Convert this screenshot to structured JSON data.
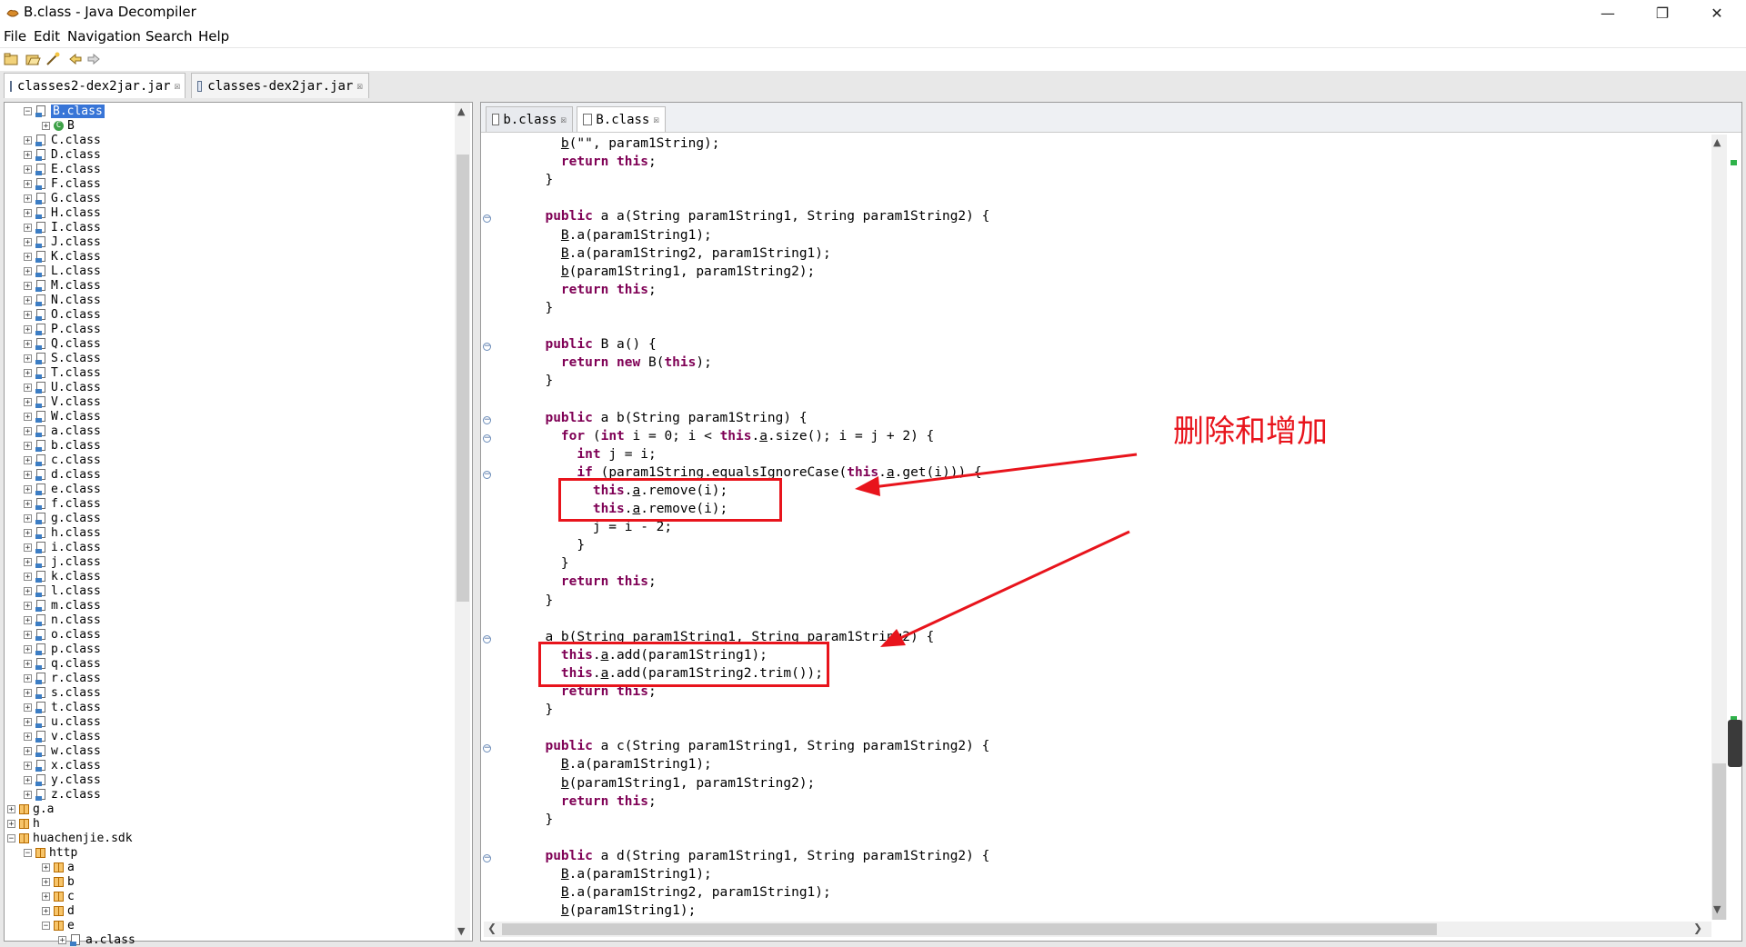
{
  "window": {
    "title": "B.class - Java Decompiler",
    "controls": [
      "minimize",
      "restore",
      "close"
    ]
  },
  "menu": [
    "File",
    "Edit",
    "Navigation",
    "Search",
    "Help"
  ],
  "toolbar": [
    "open-file-icon",
    "open-folder-icon",
    "wand-icon",
    "back-arrow-icon",
    "forward-arrow-icon"
  ],
  "editor_tabs": [
    {
      "label": "classes2-dex2jar.jar",
      "active": true
    },
    {
      "label": "classes-dex2jar.jar",
      "active": false
    }
  ],
  "tree": {
    "selected": "B.class",
    "child_class": "B",
    "classes": [
      "C.class",
      "D.class",
      "E.class",
      "F.class",
      "G.class",
      "H.class",
      "I.class",
      "J.class",
      "K.class",
      "L.class",
      "M.class",
      "N.class",
      "O.class",
      "P.class",
      "Q.class",
      "S.class",
      "T.class",
      "U.class",
      "V.class",
      "W.class",
      "a.class",
      "b.class",
      "c.class",
      "d.class",
      "e.class",
      "f.class",
      "g.class",
      "h.class",
      "i.class",
      "j.class",
      "k.class",
      "l.class",
      "m.class",
      "n.class",
      "o.class",
      "p.class",
      "q.class",
      "r.class",
      "s.class",
      "t.class",
      "u.class",
      "v.class",
      "w.class",
      "x.class",
      "y.class",
      "z.class"
    ],
    "packages_after": [
      "g.a",
      "h",
      "huachenjie.sdk"
    ],
    "sub_package": "http",
    "sub_sub_packages": [
      "a",
      "b",
      "c",
      "d",
      "e"
    ],
    "last_partial": "a.class"
  },
  "inner_tabs": [
    {
      "label": "b.class",
      "active": false
    },
    {
      "label": "B.class",
      "active": true
    }
  ],
  "code_lines": [
    "    b(\"\", param1String);",
    "    return this;",
    "  }",
    "",
    "  public a a(String param1String1, String param1String2) {",
    "    B.a(param1String1);",
    "    B.a(param1String2, param1String1);",
    "    b(param1String1, param1String2);",
    "    return this;",
    "  }",
    "",
    "  public B a() {",
    "    return new B(this);",
    "  }",
    "",
    "  public a b(String param1String) {",
    "    for (int i = 0; i < this.a.size(); i = j + 2) {",
    "      int j = i;",
    "      if (param1String.equalsIgnoreCase(this.a.get(i))) {",
    "        this.a.remove(i);",
    "        this.a.remove(i);",
    "        j = i - 2;",
    "      }",
    "    }",
    "    return this;",
    "  }",
    "",
    "  a b(String param1String1, String param1String2) {",
    "    this.a.add(param1String1);",
    "    this.a.add(param1String2.trim());",
    "    return this;",
    "  }",
    "",
    "  public a c(String param1String1, String param1String2) {",
    "    B.a(param1String1);",
    "    b(param1String1, param1String2);",
    "    return this;",
    "  }",
    "",
    "  public a d(String param1String1, String param1String2) {",
    "    B.a(param1String1);",
    "    B.a(param1String2, param1String1);",
    "    b(param1String1);"
  ],
  "annotation": {
    "text": "删除和增加",
    "color": "#e8141c"
  },
  "colors": {
    "keyword": "#7f0055",
    "selection": "#3875d7",
    "annotation_red": "#e8141c"
  }
}
